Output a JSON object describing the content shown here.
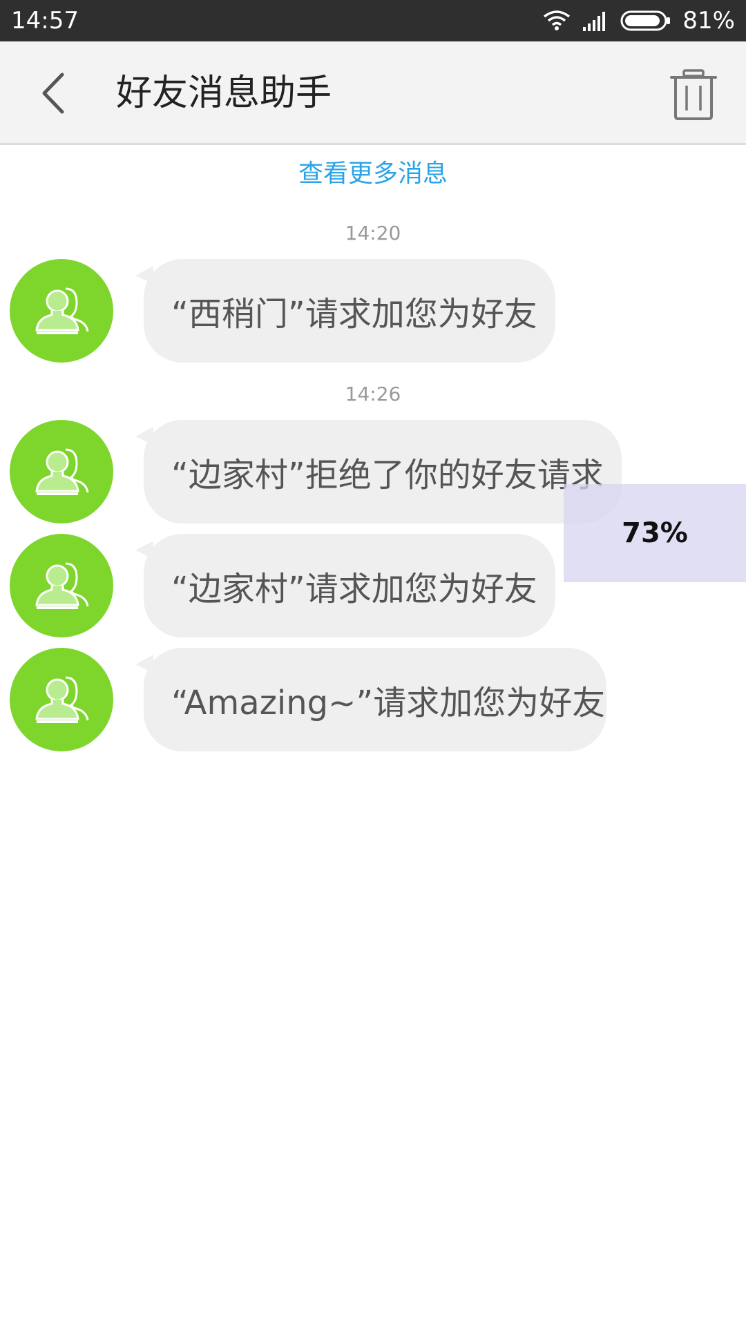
{
  "status_bar": {
    "time": "14:57",
    "battery_percent": "81%",
    "icons": [
      "wifi-icon",
      "signal-icon",
      "battery-icon"
    ]
  },
  "header": {
    "title": "好友消息助手",
    "back_icon": "back-arrow-icon",
    "trash_icon": "trash-icon"
  },
  "load_more": "查看更多消息",
  "groups": [
    {
      "time": "14:20",
      "messages": [
        "“西稍门”请求加您为好友"
      ]
    },
    {
      "time": "14:26",
      "messages": [
        "“边家村”拒绝了你的好友请求",
        "“边家村”请求加您为好友",
        "“Amazing~”请求加您为好友"
      ]
    }
  ],
  "progress": {
    "label": "73%",
    "value": 0.73
  },
  "colors": {
    "accent_link": "#2aa3e8",
    "avatar_bg": "#7ed62c",
    "bubble_bg": "#efefef",
    "status_bar_bg": "#2f2f2f",
    "app_bar_bg": "#f3f3f3"
  }
}
